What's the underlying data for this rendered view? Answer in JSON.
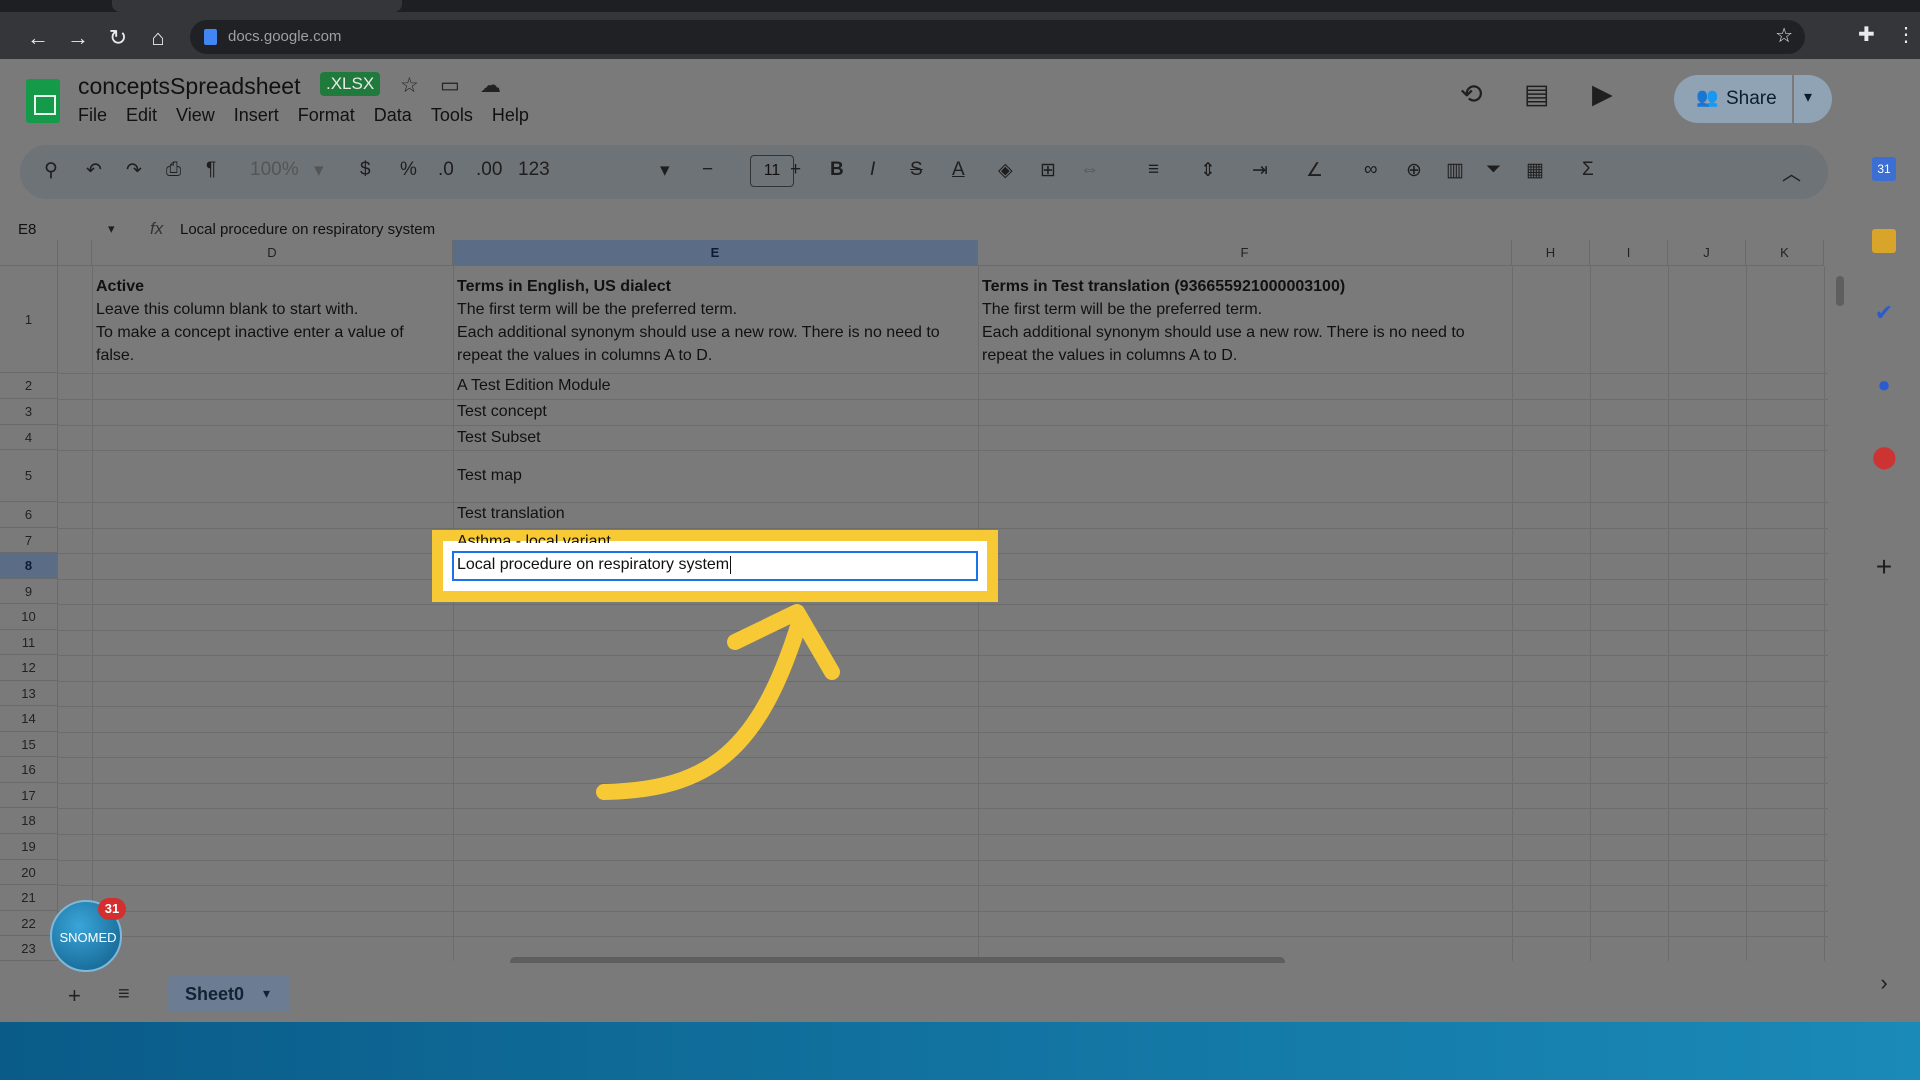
{
  "browser": {
    "url": "docs.google.com"
  },
  "doc": {
    "title": "conceptsSpreadsheet",
    "badge": ".XLSX"
  },
  "menu": [
    "File",
    "Edit",
    "View",
    "Insert",
    "Format",
    "Data",
    "Tools",
    "Help"
  ],
  "header": {
    "share_label": "Share"
  },
  "toolbar": {
    "zoom": "100%",
    "currency": "$",
    "percent": "%",
    "dec_decrease": ".0",
    "dec_increase": ".00",
    "number_format": "123",
    "font_size": "11",
    "bold": "B",
    "italic": "I",
    "strike": "S",
    "text_color": "A",
    "sum": "Σ"
  },
  "formula_bar": {
    "cell_ref": "E8",
    "fx": "fx",
    "content": "Local procedure on respiratory system"
  },
  "columns": [
    {
      "label": "D",
      "selected": false
    },
    {
      "label": "E",
      "selected": true
    },
    {
      "label": "F",
      "selected": false
    },
    {
      "label": "H",
      "selected": false
    },
    {
      "label": "I",
      "selected": false
    },
    {
      "label": "J",
      "selected": false
    },
    {
      "label": "K",
      "selected": false
    }
  ],
  "rows": [
    "1",
    "2",
    "3",
    "4",
    "5",
    "6",
    "7",
    "8",
    "9",
    "10",
    "11",
    "12",
    "13",
    "14",
    "15",
    "16",
    "17",
    "18",
    "19",
    "20",
    "21",
    "22",
    "23"
  ],
  "selected_row": "8",
  "cells": {
    "d1": {
      "header": "Active",
      "line1": "Leave this column blank to start with.",
      "line2": "To make a concept inactive enter a value of",
      "line3": "false."
    },
    "e1": {
      "header": "Terms in English, US dialect",
      "line1": "The first term will be the preferred term.",
      "line2": "Each additional synonym should use a new row. There is no need to",
      "line3": "repeat the values in columns A to D."
    },
    "f1": {
      "header": "Terms in Test translation (936655921000003100)",
      "line1": "The first term will be the preferred term.",
      "line2": "Each additional synonym should use a new row. There is no need to",
      "line3": "repeat the values in columns A to D."
    },
    "e2": "A Test Edition Module",
    "e3": "Test concept",
    "e4": "Test Subset",
    "e5": "Test map",
    "e6": "Test translation",
    "e7": "Asthma - local variant",
    "e8": "Local procedure on respiratory system"
  },
  "sheets": {
    "active": "Sheet0"
  },
  "snomed_widget": {
    "label": "SNOMED",
    "badge_count": "31"
  },
  "highlight_color": "#f7c935",
  "accent_color": "#1a73e8"
}
